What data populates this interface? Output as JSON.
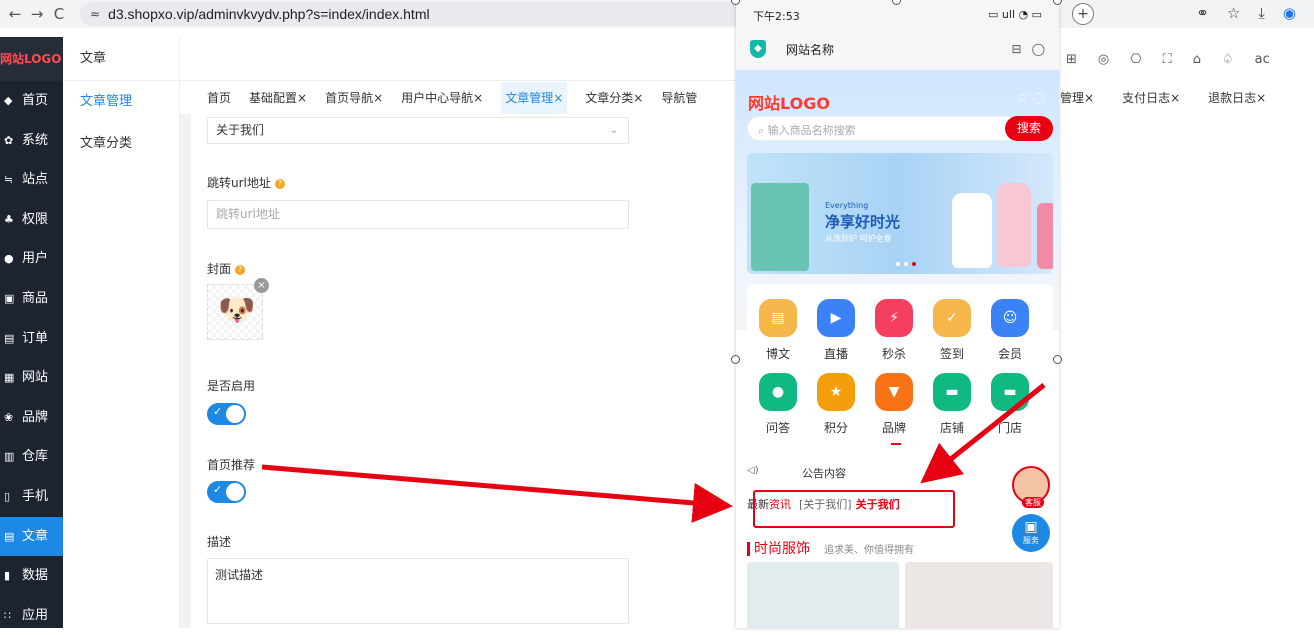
{
  "browser": {
    "url": "d3.shopxo.vip/adminvkvydv.php?s=index/index.html",
    "back_icon": "←",
    "forward_icon": "→",
    "reload_icon": "C",
    "tune_icon": "≈",
    "new_tab_icon": "+",
    "right_icons": [
      "⚭",
      "☆",
      "⤓",
      "◉"
    ]
  },
  "sidebar": {
    "logo": "网站LOGO",
    "items": [
      {
        "icon": "◆",
        "label": "首页"
      },
      {
        "icon": "✿",
        "label": "系统"
      },
      {
        "icon": "≒",
        "label": "站点"
      },
      {
        "icon": "♣",
        "label": "权限"
      },
      {
        "icon": "●",
        "label": "用户"
      },
      {
        "icon": "▣",
        "label": "商品"
      },
      {
        "icon": "▤",
        "label": "订单"
      },
      {
        "icon": "▦",
        "label": "网站"
      },
      {
        "icon": "❀",
        "label": "品牌"
      },
      {
        "icon": "▥",
        "label": "仓库"
      },
      {
        "icon": "▯",
        "label": "手机"
      },
      {
        "icon": "▤",
        "label": "文章"
      },
      {
        "icon": "▮",
        "label": "数据"
      },
      {
        "icon": "∷",
        "label": "应用"
      }
    ]
  },
  "subside": {
    "title": "文章",
    "items": [
      "文章管理",
      "文章分类"
    ]
  },
  "tabs": [
    "首页",
    "基础配置×",
    "首页导航×",
    "用户中心导航×",
    "文章管理×",
    "文章分类×",
    "导航管"
  ],
  "tabs_right": [
    "管理×",
    "支付日志×",
    "退款日志×"
  ],
  "right_tools": [
    "⊞",
    "◎",
    "⎔",
    "⛶",
    "⌂",
    "♤",
    "ac"
  ],
  "form": {
    "category_value": "关于我们",
    "jump_url_label": "跳转url地址",
    "jump_url_placeholder": "跳转url地址",
    "cover_label": "封面",
    "enabled_label": "是否启用",
    "home_recommend_label": "首页推荐",
    "description_label": "描述",
    "description_value": "测试描述",
    "help_icon": "?",
    "toggle_check": "✓",
    "chevron_icon": "⌄",
    "remove_icon": "×",
    "cover_emoji": "🐶"
  },
  "phone": {
    "time": "下午2:53",
    "status_right": "▭ ull ◔ ▭",
    "page_title": "网站名称",
    "head_icons": [
      "⊟",
      "◯"
    ],
    "logo": "网站LOGO",
    "search_placeholder": "输入商品名称搜索",
    "search_button": "搜索",
    "banner_tag": "Everything",
    "banner_small": "",
    "banner_title": "净享好时光",
    "banner_subtitle": "从洗到护 呵护全身",
    "grid": [
      {
        "label": "博文",
        "color": "#f5b64a",
        "icon": "▤"
      },
      {
        "label": "直播",
        "color": "#3b82f6",
        "icon": "▶"
      },
      {
        "label": "秒杀",
        "color": "#f43f5e",
        "icon": "⚡"
      },
      {
        "label": "签到",
        "color": "#f5b64a",
        "icon": "✓"
      },
      {
        "label": "会员",
        "color": "#3b82f6",
        "icon": "☺"
      },
      {
        "label": "问答",
        "color": "#10b981",
        "icon": "●"
      },
      {
        "label": "积分",
        "color": "#f59e0b",
        "icon": "★"
      },
      {
        "label": "品牌",
        "color": "#f97316",
        "icon": "▼"
      },
      {
        "label": "店铺",
        "color": "#10b981",
        "icon": "▬"
      },
      {
        "label": "门店",
        "color": "#10b981",
        "icon": "▬"
      }
    ],
    "notice_icon": "◁)",
    "notice": "公告内容",
    "news_a": "最新",
    "news_b": "资讯",
    "news_c": "[关于我们]",
    "news_d": "关于我们",
    "fashion_title": "时尚服饰",
    "fashion_sub": "追求美、你值得拥有",
    "float_kefu": "客服",
    "float_service": "服务",
    "float_service_icon": "▣"
  },
  "colors": {
    "accent": "#1e88e5",
    "red": "#e60012",
    "sidebar_bg": "#1e2330"
  }
}
